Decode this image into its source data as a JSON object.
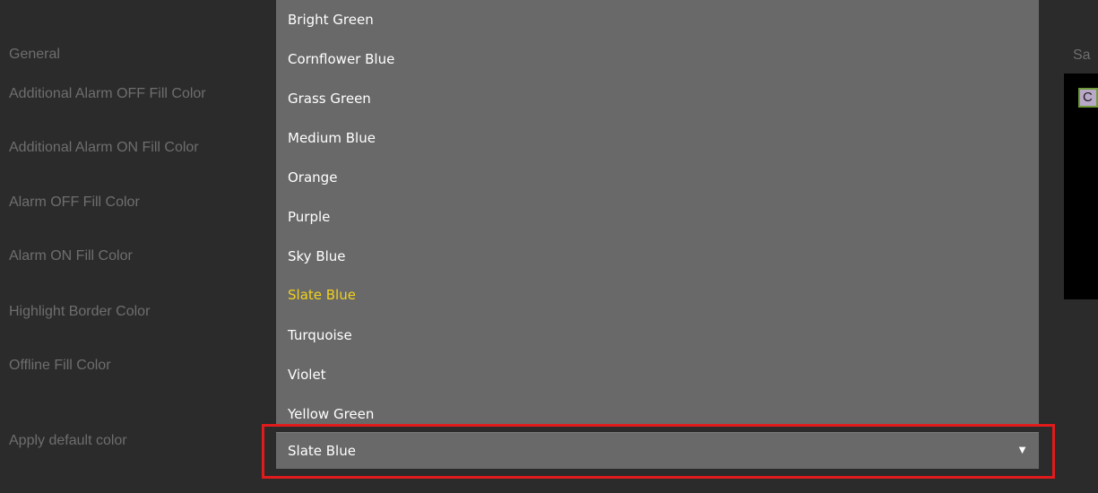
{
  "left_labels": [
    "General",
    "Additional Alarm OFF Fill Color",
    "Additional Alarm ON Fill Color",
    "Alarm OFF Fill Color",
    "Alarm ON Fill Color",
    "Highlight Border Color",
    "Offline Fill Color",
    "Apply default color"
  ],
  "dropdown": {
    "options": [
      "Bright Green",
      "Cornflower Blue",
      "Grass Green",
      "Medium Blue",
      "Orange",
      "Purple",
      "Sky Blue",
      "Slate Blue",
      "Turquoise",
      "Violet",
      "Yellow Green"
    ],
    "selected": "Slate Blue",
    "caret": "▼"
  },
  "sample": {
    "label": "Sa",
    "swatch_text": "C",
    "swatch_color": "#b9a8c8"
  },
  "colors": {
    "background": "#2b2b2b",
    "dropdown_bg": "#696969",
    "selected_text": "#f2d21b",
    "highlight_border": "#e11b1b"
  }
}
